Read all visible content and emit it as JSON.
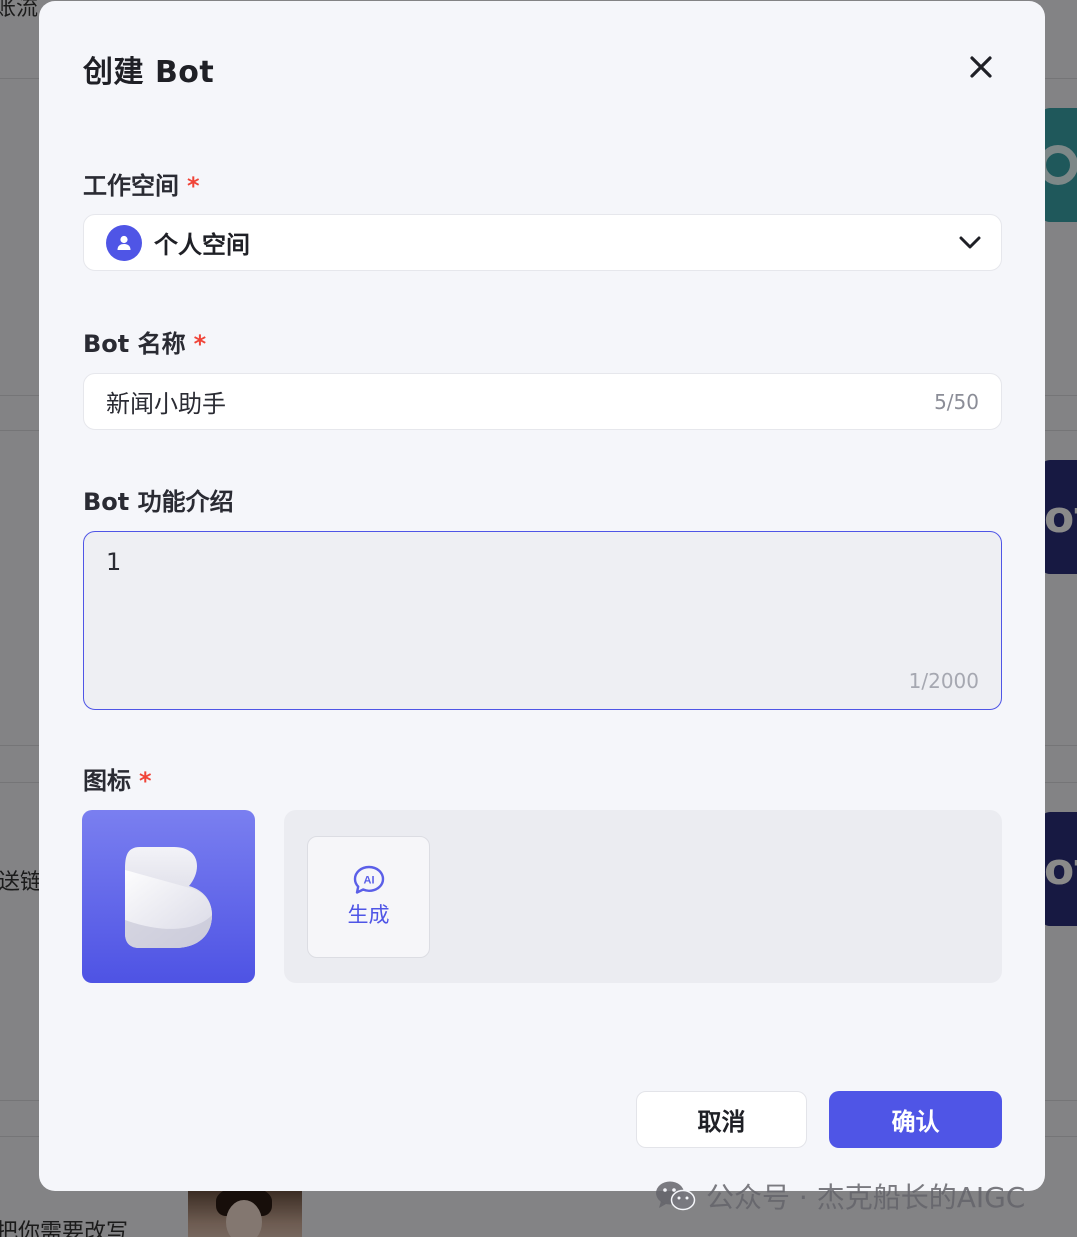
{
  "modal": {
    "title": "创建 Bot",
    "close_icon": "close-icon"
  },
  "workspace": {
    "label": "工作空间",
    "required_mark": "*",
    "selected": "个人空间",
    "avatar_icon": "user-icon",
    "dropdown_icon": "chevron-down-icon"
  },
  "bot_name": {
    "label": "Bot 名称",
    "required_mark": "*",
    "value": "新闻小助手",
    "counter": "5/50"
  },
  "bot_description": {
    "label": "Bot 功能介绍",
    "value": "1",
    "counter": "1/2000"
  },
  "icon_section": {
    "label": "图标",
    "required_mark": "*",
    "preview_icon": "bot-logo-icon",
    "ai_generate_label": "生成",
    "ai_badge": "AI"
  },
  "actions": {
    "cancel_label": "取消",
    "confirm_label": "确认"
  },
  "background": {
    "fragment_top": "账流",
    "fragment_mid": "送链",
    "fragment_bottom": "把你需要改写",
    "card_text": "ot"
  },
  "watermark": {
    "text": "公众号 · 杰克船长的AIGC"
  },
  "colors": {
    "accent": "#4f55e6",
    "required": "#f04438"
  }
}
